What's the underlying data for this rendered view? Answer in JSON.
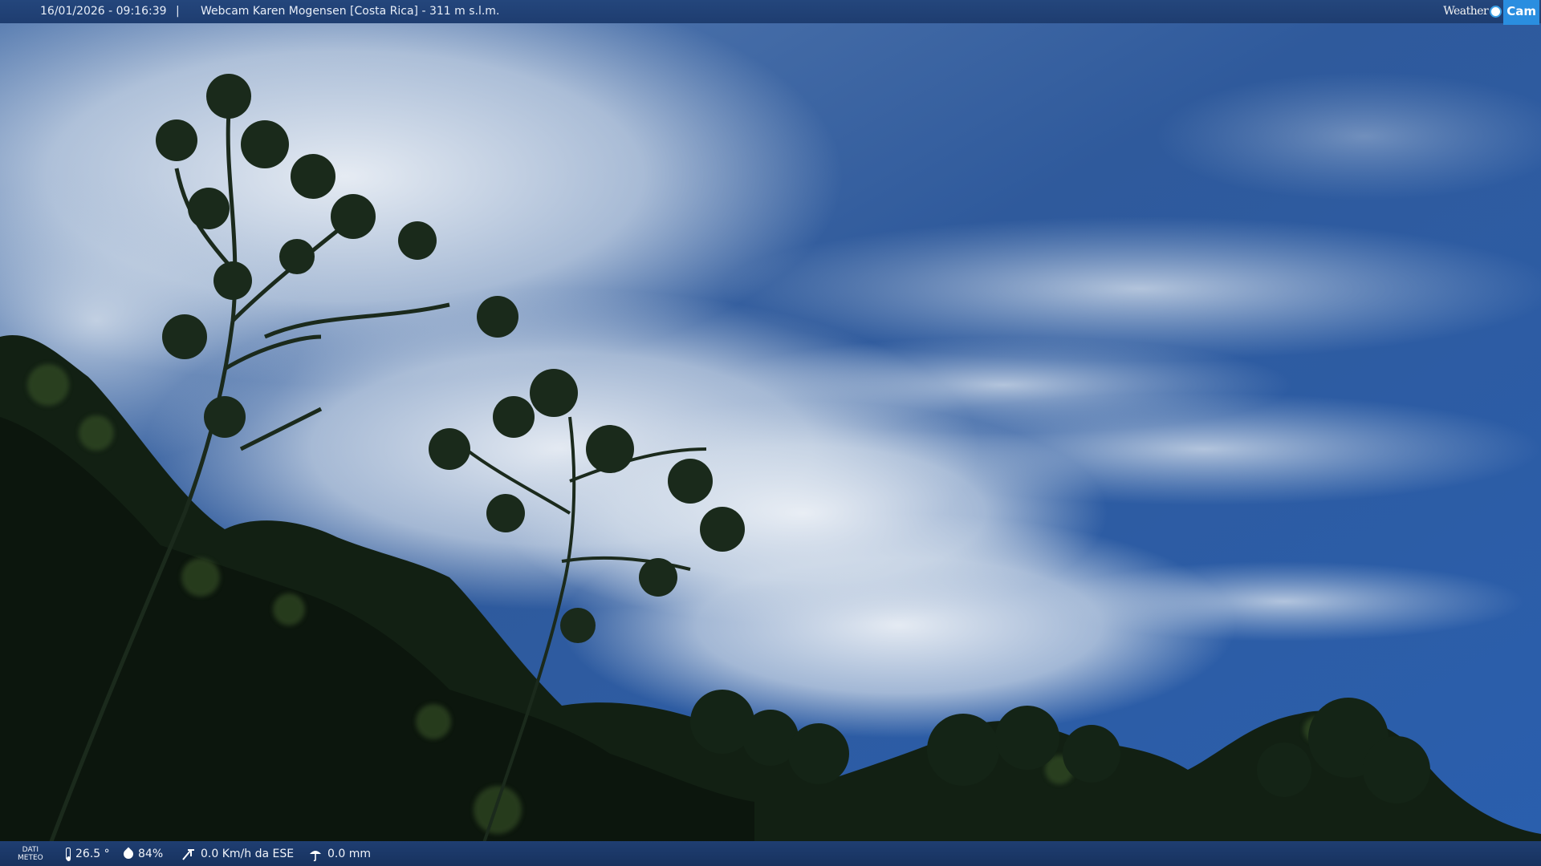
{
  "header": {
    "timestamp": "16/01/2026 - 09:16:39",
    "separator": "|",
    "title": "Webcam Karen Mogensen [Costa Rica] - 311 m s.l.m.",
    "logo_weather": "Weather",
    "logo_cam": "Cam"
  },
  "footer": {
    "dati_line1": "DATI",
    "dati_line2": "METEO",
    "temperature": "26.5 °",
    "humidity": "84%",
    "wind": "0.0 Km/h da ESE",
    "rain": "0.0 mm"
  },
  "icons": {
    "temperature": "thermometer-icon",
    "humidity": "humidity-drop-icon",
    "wind": "wind-icon",
    "rain": "rain-icon"
  },
  "colors": {
    "bar": "#1f3e72",
    "sky_top": "#1f3f7a",
    "sky_mid": "#3a6aac",
    "cloud": "#e3eaf2",
    "foliage_dark": "#0d1a0f",
    "foliage_light": "#3e5a2c",
    "logo_accent": "#2a8ee0"
  }
}
